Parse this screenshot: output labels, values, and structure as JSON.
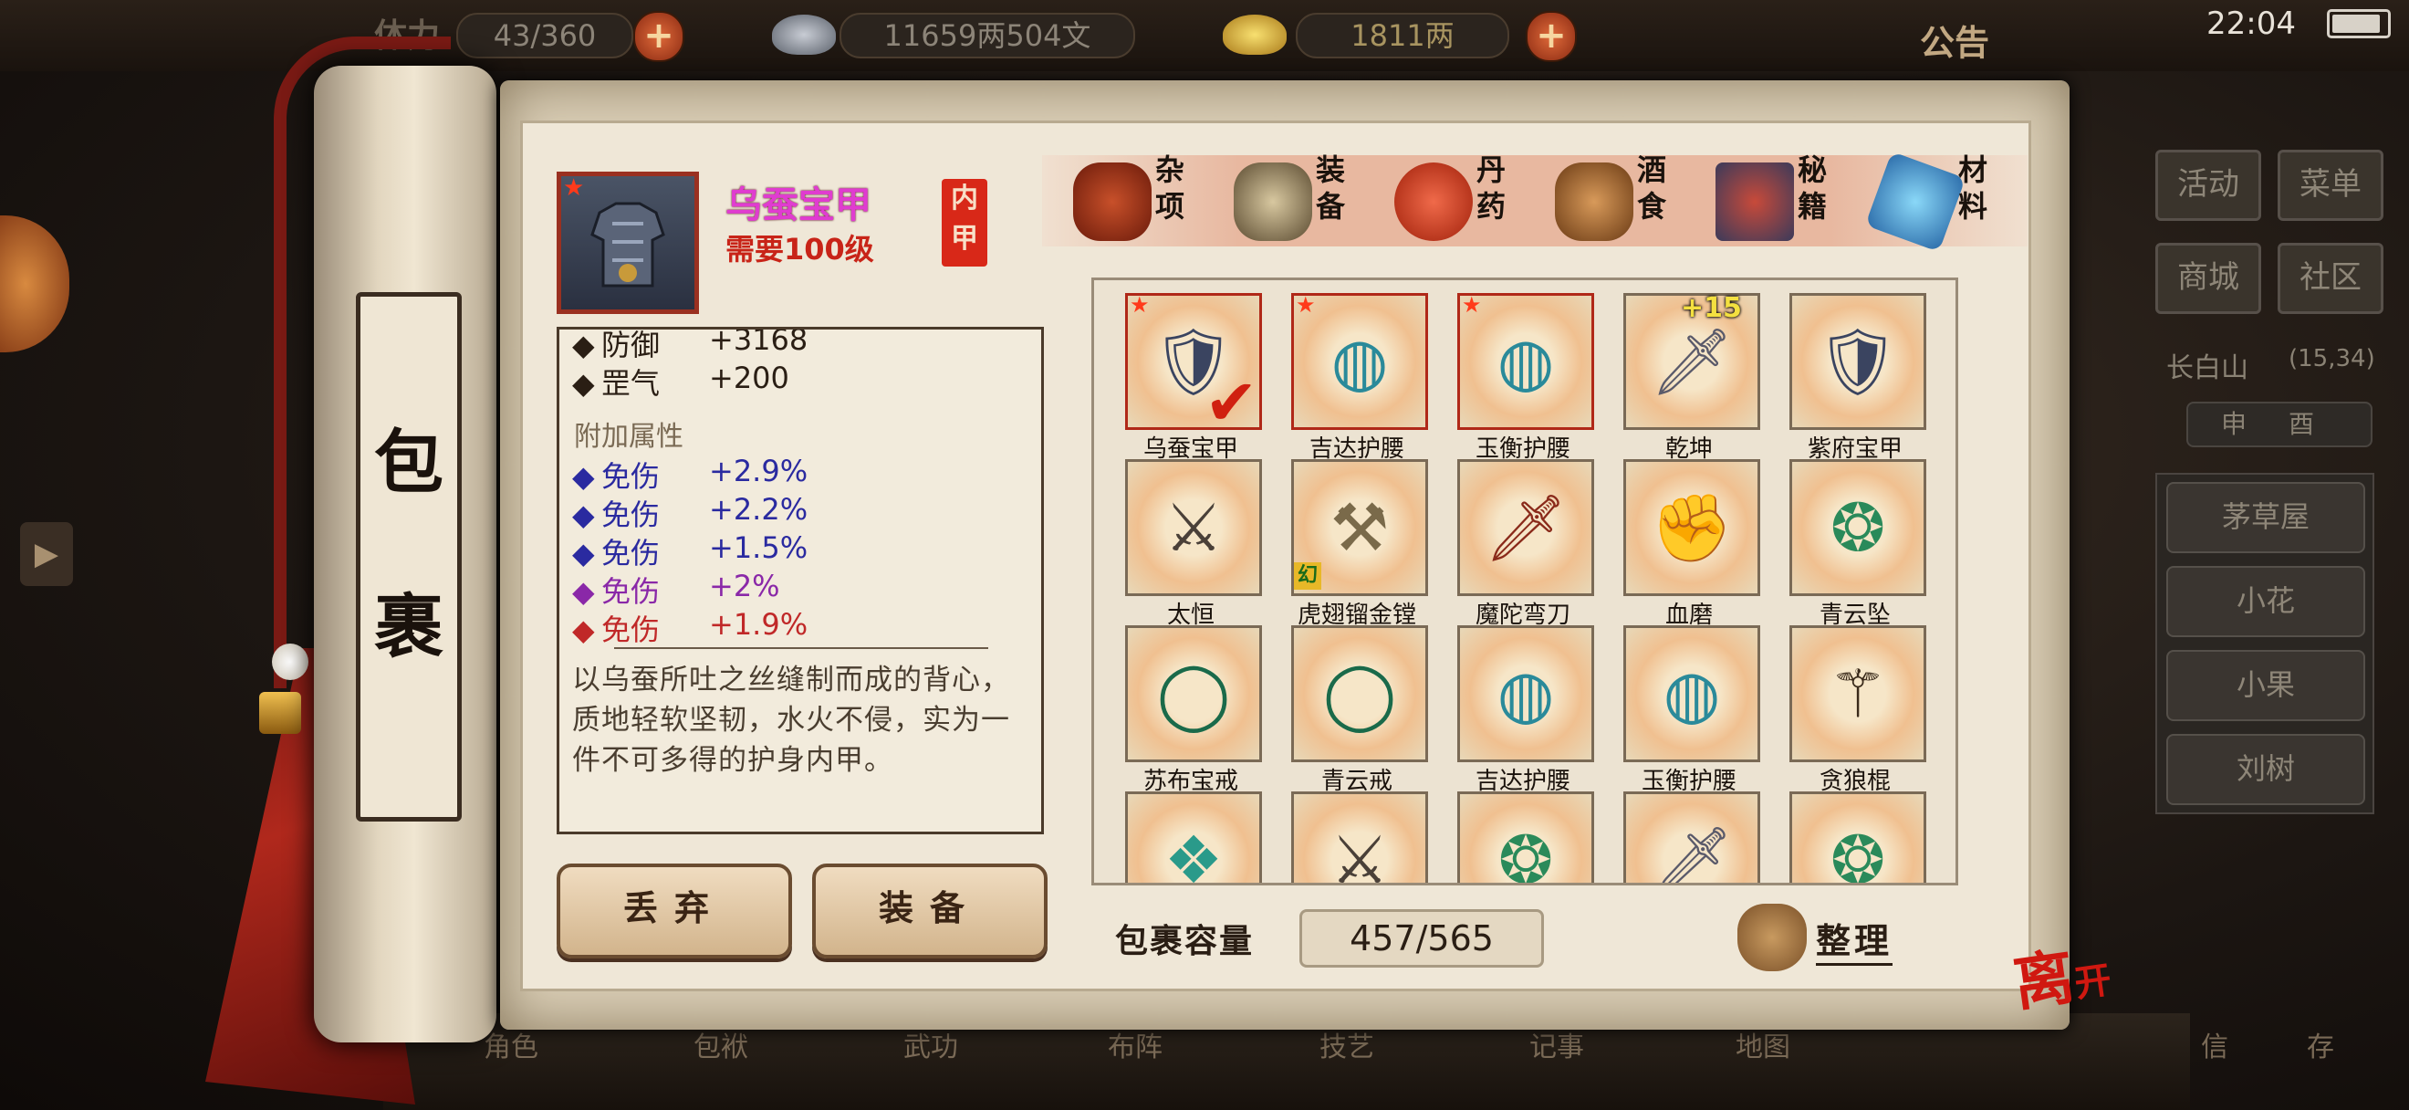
{
  "topbar": {
    "stamina_label": "体力",
    "stamina_value": "43/360",
    "silver_value": "11659两504文",
    "gold_value": "1811两",
    "notice_label": "公告",
    "clock": "22:04"
  },
  "side_menu": {
    "activity": "活动",
    "menu": "菜单",
    "shop": "商城",
    "community": "社区",
    "location_name": "长白山",
    "location_coords": "(15,34)",
    "time_marks": [
      "申",
      "酉"
    ],
    "npcs": [
      "茅草屋",
      "小花",
      "小果",
      "刘树"
    ]
  },
  "bottom_nav": [
    "角色",
    "包袱",
    "武功",
    "布阵",
    "技艺",
    "记事",
    "地图",
    "信",
    "存"
  ],
  "scroll_title": [
    "包",
    "裹"
  ],
  "selected_item": {
    "name": "乌蚕宝甲",
    "requirement": "需要100级",
    "slot_seal": [
      "内",
      "甲"
    ],
    "base_stats": [
      {
        "label": "防御",
        "value": "+3168"
      },
      {
        "label": "罡气",
        "value": "+200"
      }
    ],
    "extra_title": "附加属性",
    "extra_stats": [
      {
        "label": "免伤",
        "value": "+2.9%",
        "color": "#2a2aa0"
      },
      {
        "label": "免伤",
        "value": "+2.2%",
        "color": "#2a2aa0"
      },
      {
        "label": "免伤",
        "value": "+1.5%",
        "color": "#2a2aa0"
      },
      {
        "label": "免伤",
        "value": "+2%",
        "color": "#8a28a8"
      },
      {
        "label": "免伤",
        "value": "+1.9%",
        "color": "#c02828"
      }
    ],
    "description": "以乌蚕所吐之丝缝制而成的背心，质地轻软坚韧，水火不侵，实为一件不可多得的护身内甲。"
  },
  "actions": {
    "discard": "丢弃",
    "equip": "装备"
  },
  "tabs": [
    {
      "label": "杂项",
      "icon": "jar-icon"
    },
    {
      "label": "装备",
      "icon": "equipment-icon"
    },
    {
      "label": "丹药",
      "icon": "pill-icon"
    },
    {
      "label": "酒食",
      "icon": "wine-icon"
    },
    {
      "label": "秘籍",
      "icon": "book-icon"
    },
    {
      "label": "材料",
      "icon": "crystal-icon"
    }
  ],
  "items": [
    {
      "name": "乌蚕宝甲",
      "icon": "armor-icon",
      "starred": true,
      "selected": true,
      "equipped": true
    },
    {
      "name": "吉达护腰",
      "icon": "belt-icon",
      "starred": true,
      "selected": true
    },
    {
      "name": "玉衡护腰",
      "icon": "belt-icon",
      "starred": true,
      "selected": true
    },
    {
      "name": "乾坤",
      "icon": "dagger-icon",
      "badge": "+15"
    },
    {
      "name": "紫府宝甲",
      "icon": "armor-icon"
    },
    {
      "name": "太恒",
      "icon": "sword-icon"
    },
    {
      "name": "虎翅镏金镗",
      "icon": "polearm-icon",
      "tag": "幻"
    },
    {
      "name": "魔陀弯刀",
      "icon": "blade-icon"
    },
    {
      "name": "血磨",
      "icon": "gauntlet-icon"
    },
    {
      "name": "青云坠",
      "icon": "pendant-icon"
    },
    {
      "name": "苏布宝戒",
      "icon": "ring-icon"
    },
    {
      "name": "青云戒",
      "icon": "ring-icon"
    },
    {
      "name": "吉达护腰",
      "icon": "belt-icon"
    },
    {
      "name": "玉衡护腰",
      "icon": "belt-icon"
    },
    {
      "name": "贪狼棍",
      "icon": "staff-icon"
    },
    {
      "name": "",
      "icon": "dragon-icon"
    },
    {
      "name": "",
      "icon": "sword-icon"
    },
    {
      "name": "",
      "icon": "pendant-icon"
    },
    {
      "name": "",
      "icon": "dagger-icon"
    },
    {
      "name": "",
      "icon": "pendant-icon"
    }
  ],
  "capacity": {
    "label": "包裹容量",
    "value": "457/565"
  },
  "sort_label": "整理",
  "leave_label": [
    "离",
    "开"
  ]
}
